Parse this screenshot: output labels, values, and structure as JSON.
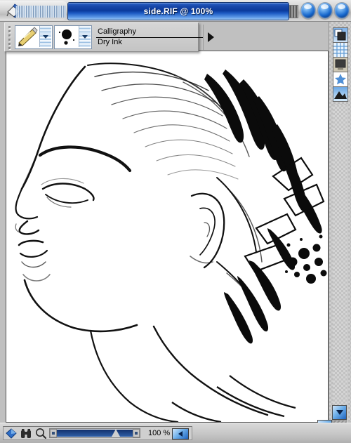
{
  "window": {
    "title": "side.RIF @ 100%",
    "left_icon": "paint-bucket-icon",
    "controls": [
      {
        "name": "minimize-button",
        "icon": "orb-icon"
      },
      {
        "name": "zoom-button",
        "icon": "orb-icon"
      },
      {
        "name": "close-button",
        "icon": "orb-icon"
      }
    ]
  },
  "brush_selector": {
    "category_swatch_icon": "calligraphy-pen-icon",
    "variant_swatch_icon": "round-dab-icon",
    "category": "Calligraphy",
    "variant": "Dry Ink",
    "expand_arrow_icon": "triangle-right-icon"
  },
  "right_palette": {
    "items": [
      {
        "name": "palette-layers-icon",
        "icon": "layers-icon"
      },
      {
        "name": "palette-grid-icon",
        "icon": "grid-icon"
      },
      {
        "name": "palette-screen-icon",
        "icon": "monitor-icon"
      },
      {
        "name": "palette-star-icon",
        "icon": "star-icon"
      },
      {
        "name": "palette-image-icon",
        "icon": "mountain-image-icon"
      }
    ]
  },
  "scroll": {
    "down_arrow_icon": "chevron-down-icon",
    "right_arrow_icon": "chevron-right-icon",
    "resize_grip_icon": "resize-grip-icon"
  },
  "statusbar": {
    "icons": [
      {
        "name": "color-diamond-icon",
        "icon": "diamond-icon"
      },
      {
        "name": "navigator-icon",
        "icon": "binoculars-icon"
      },
      {
        "name": "magnifier-icon",
        "icon": "magnifier-icon"
      }
    ],
    "zoom_value": "100 %",
    "back_arrow_icon": "chevron-left-icon"
  },
  "artwork": {
    "title": "female-profile-line-art",
    "description": "Ink line drawing of a woman's head in left-facing profile with swept-back hair"
  },
  "colors": {
    "titlebar_blue": "#0b3a9c",
    "window_chrome": "#c0c0c0",
    "canvas_white": "#ffffff",
    "ink_black": "#000000",
    "accent_blue": "#1d62bf"
  }
}
